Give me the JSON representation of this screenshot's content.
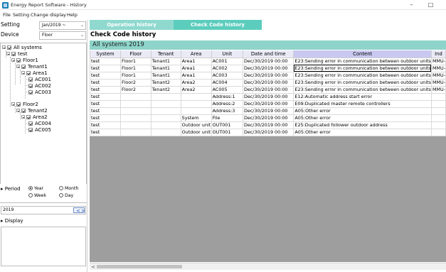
{
  "window": {
    "title": "Energy Report Software - History",
    "minimize": "–",
    "maximize": "□"
  },
  "menu": [
    "File",
    "Setting",
    "Change display",
    "Help"
  ],
  "left": {
    "setting_label": "Setting",
    "setting_value": "Jan/2019 ~",
    "device_label": "Device",
    "device_value": "Floor",
    "tree": [
      {
        "label": "All systems"
      },
      {
        "label": "test"
      },
      {
        "label": "Floor1"
      },
      {
        "label": "Tenant1"
      },
      {
        "label": "Area1"
      },
      {
        "label": "AC001"
      },
      {
        "label": "AC002"
      },
      {
        "label": "AC003"
      },
      {
        "label": "Floor2"
      },
      {
        "label": "Tenant2"
      },
      {
        "label": "Area2"
      },
      {
        "label": "AC004"
      },
      {
        "label": "AC005"
      }
    ],
    "period": {
      "label": "Period",
      "options": [
        "Year",
        "Month",
        "Week",
        "Day"
      ],
      "selected": "Year"
    },
    "year_value": "2019",
    "display_label": "Display"
  },
  "tabs": {
    "operation": "Operation history",
    "checkcode": "Check Code history",
    "active": "Check Code history"
  },
  "page_title": "Check Code history",
  "summary": "All systems  2019",
  "table": {
    "columns": [
      "System",
      "Floor",
      "Tenant",
      "Area",
      "Unit",
      "Date and time",
      "Content",
      "Ind"
    ],
    "rows": [
      [
        "test",
        "Floor1",
        "Tenant1",
        "Area1",
        "AC001",
        "Dec/30/2019 00:00",
        "E23:Sending error in communication between outdoor units",
        "MMU-"
      ],
      [
        "test",
        "Floor1",
        "Tenant1",
        "Area1",
        "AC002",
        "Dec/30/2019 00:00",
        "E23:Sending error in communication between outdoor units",
        "MMU-"
      ],
      [
        "test",
        "Floor1",
        "Tenant1",
        "Area1",
        "AC003",
        "Dec/30/2019 00:00",
        "E23:Sending error in communication between outdoor units",
        "MMU-"
      ],
      [
        "test",
        "Floor2",
        "Tenant2",
        "Area2",
        "AC004",
        "Dec/30/2019 00:00",
        "E23:Sending error in communication between outdoor units",
        "MMU-"
      ],
      [
        "test",
        "Floor2",
        "Tenant2",
        "Area2",
        "AC005",
        "Dec/30/2019 00:00",
        "E23:Sending error in communication between outdoor units",
        "MMU-"
      ],
      [
        "test",
        "",
        "",
        "",
        "Address:1",
        "Dec/30/2019 00:00",
        "E12:Automatic address start error",
        ""
      ],
      [
        "test",
        "",
        "",
        "",
        "Address:2",
        "Dec/30/2019 00:00",
        "E09:Duplicated master remote controllers",
        ""
      ],
      [
        "test",
        "",
        "",
        "",
        "Address:3",
        "Dec/30/2019 00:00",
        "A05:Other error",
        ""
      ],
      [
        "test",
        "",
        "",
        "System",
        "File",
        "Dec/30/2019 00:00",
        "A05:Other error",
        ""
      ],
      [
        "test",
        "",
        "",
        "Outdoor unit",
        "OUT001",
        "Dec/30/2019 00:00",
        "E25:Duplicated follower outdoor address",
        ""
      ],
      [
        "test",
        "",
        "",
        "Outdoor unit",
        "OUT001",
        "Dec/30/2019 00:00",
        "A05:Other error",
        ""
      ]
    ],
    "selected_row": 1,
    "selected_col": 6
  },
  "colors": {
    "tab_active": "#5ccdbd",
    "tab_inactive": "#8fd9cf",
    "summary_band": "#8ed4ca",
    "content_header": "#c8c8f0",
    "grid_empty": "#9e9e9e"
  },
  "icons": {
    "spin_left": "<",
    "spin_right": ">",
    "scroll_left": "<"
  }
}
